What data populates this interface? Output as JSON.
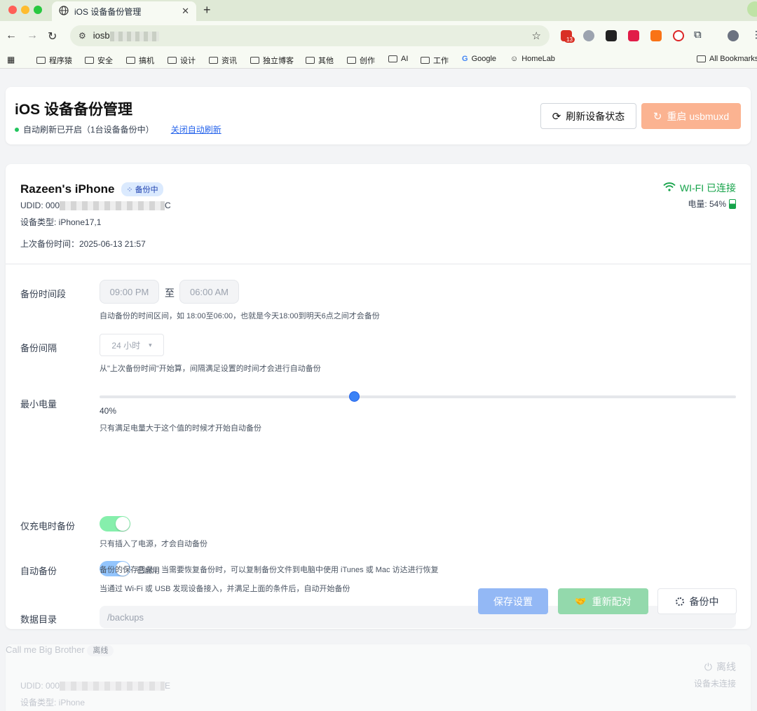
{
  "browser": {
    "tab_title": "iOS 设备备份管理",
    "url_prefix": "iosb",
    "bookmarks": [
      "程序猿",
      "安全",
      "搞机",
      "设计",
      "资讯",
      "独立博客",
      "其他",
      "创作",
      "AI",
      "工作",
      "Google",
      "HomeLab",
      "All Bookmarks"
    ],
    "ext_badge": "13"
  },
  "header": {
    "title": "iOS 设备备份管理",
    "status_text": "自动刷新已开启（1台设备备份中）",
    "toggle_link": "关闭自动刷新",
    "refresh_label": "刷新设备状态",
    "restart_label": "重启 usbmuxd"
  },
  "device1": {
    "name": "Razeen's iPhone",
    "badge": "备份中",
    "udid_label": "UDID: 000",
    "udid_suffix": "C",
    "type": "设备类型: iPhone17,1",
    "last_backup": "上次备份时间：2025-06-13 21:57",
    "connection": "WI-FI 已连接",
    "battery": "电量: 54%",
    "battery_level": 54,
    "settings": {
      "window_label": "备份时间段",
      "start_time": "09:00 PM",
      "to": "至",
      "end_time": "06:00 AM",
      "window_help": "自动备份的时间区间，如 18:00至06:00，也就是今天18:00到明天6点之间才会备份",
      "interval_label": "备份间隔",
      "interval_value": "24 小时",
      "interval_help": "从\"上次备份时间\"开始算，间隔满足设置的时间才会进行自动备份",
      "min_battery_label": "最小电量",
      "min_battery_value": 40,
      "min_battery_text": "40%",
      "min_battery_help": "只有满足电量大于这个值的时候才开始自动备份",
      "charging_label": "仅充电时备份",
      "charging_on": true,
      "charging_help": "只有插入了电源，才会自动备份",
      "auto_label": "自动备份",
      "auto_on": true,
      "auto_state": "已启用",
      "auto_help": "当通过 Wi-Fi 或 USB 发现设备接入，并满足上面的条件后，自动开始备份",
      "dir_label": "数据目录",
      "dir_value": "/backups",
      "dir_help": "备份的保存目录，当需要恢复备份时，可以复制备份文件到电脑中使用 iTunes 或 Mac 访达进行恢复"
    },
    "actions": {
      "save": "保存设置",
      "repair": "重新配对",
      "busy": "备份中"
    }
  },
  "device2": {
    "name": "Call me Big Brother",
    "badge": "离线",
    "udid_label": "UDID: 000",
    "udid_suffix": "E",
    "type": "设备类型: iPhone",
    "status": "离线",
    "status_sub": "设备未连接"
  },
  "colors": {
    "accent": "#3b82f6",
    "success": "#16a34a",
    "warning": "#fbb391"
  }
}
